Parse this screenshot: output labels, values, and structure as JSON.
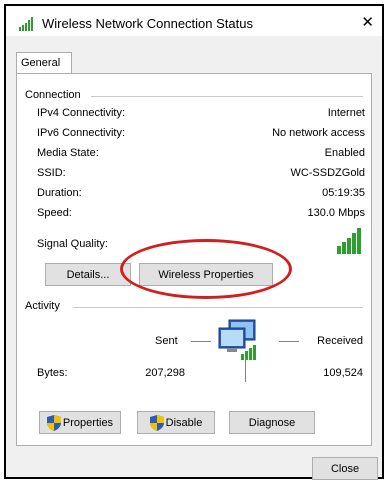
{
  "window": {
    "title": "Wireless Network Connection Status",
    "close_glyph": "✕"
  },
  "tabs": [
    {
      "label": "General"
    }
  ],
  "connection": {
    "heading": "Connection",
    "rows": [
      {
        "label": "IPv4 Connectivity:",
        "value": "Internet"
      },
      {
        "label": "IPv6 Connectivity:",
        "value": "No network access"
      },
      {
        "label": "Media State:",
        "value": "Enabled"
      },
      {
        "label": "SSID:",
        "value": "WC-SSDZGold"
      },
      {
        "label": "Duration:",
        "value": "05:19:35"
      },
      {
        "label": "Speed:",
        "value": "130.0 Mbps"
      }
    ],
    "signal_label": "Signal Quality:",
    "signal_bars": 5,
    "details_button": "Details...",
    "wireless_properties_button": "Wireless Properties"
  },
  "activity": {
    "heading": "Activity",
    "sent_label": "Sent",
    "received_label": "Received",
    "bytes_label": "Bytes:",
    "bytes_sent": "207,298",
    "bytes_received": "109,524"
  },
  "buttons": {
    "properties": "Properties",
    "disable": "Disable",
    "diagnose": "Diagnose",
    "close": "Close"
  },
  "colors": {
    "signal_green": "#2e9e2e",
    "highlight_red": "#d0201e",
    "shield_blue": "#2b5cb8",
    "shield_yellow": "#f2c200"
  }
}
